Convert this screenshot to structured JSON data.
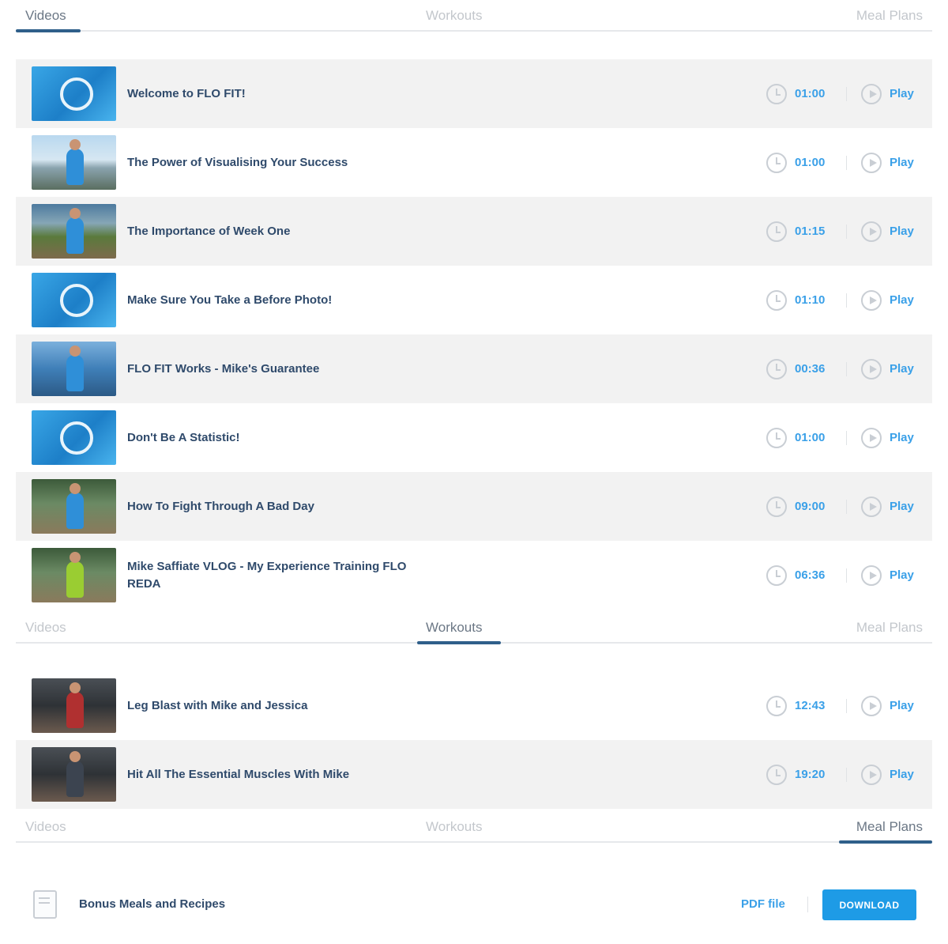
{
  "tabs": [
    "Videos",
    "Workouts",
    "Meal Plans"
  ],
  "videos": [
    {
      "title": "Welcome to FLO FIT!",
      "duration": "01:00",
      "play": "Play",
      "thumb": "logo"
    },
    {
      "title": "The Power of Visualising Your Success",
      "duration": "01:00",
      "play": "Play",
      "thumb": "photo-sky"
    },
    {
      "title": "The Importance of Week One",
      "duration": "01:15",
      "play": "Play",
      "thumb": "photo-park"
    },
    {
      "title": "Make Sure You Take a Before Photo!",
      "duration": "01:10",
      "play": "Play",
      "thumb": "logo"
    },
    {
      "title": "FLO FIT Works - Mike's Guarantee",
      "duration": "00:36",
      "play": "Play",
      "thumb": "photo-lake"
    },
    {
      "title": "Don't Be A Statistic!",
      "duration": "01:00",
      "play": "Play",
      "thumb": "logo"
    },
    {
      "title": "How To Fight Through A Bad Day",
      "duration": "09:00",
      "play": "Play",
      "thumb": "photo-trees"
    },
    {
      "title": "Mike Saffiate VLOG - My Experience Training FLO REDA",
      "duration": "06:36",
      "play": "Play",
      "thumb": "photo-trees"
    }
  ],
  "workouts": [
    {
      "title": "Leg Blast with Mike and Jessica",
      "duration": "12:43",
      "play": "Play",
      "thumb": "photo-gym"
    },
    {
      "title": "Hit All The Essential Muscles With Mike",
      "duration": "19:20",
      "play": "Play",
      "thumb": "photo-gym"
    }
  ],
  "meal_plans": [
    {
      "title": "Bonus Meals and Recipes",
      "file_label": "PDF file",
      "button_label": "DOWNLOAD"
    }
  ],
  "colors": {
    "accent": "#3aa0e8",
    "button": "#1e9be6",
    "active_underline": "#2f5f8a",
    "row_alt": "#f2f2f2"
  }
}
